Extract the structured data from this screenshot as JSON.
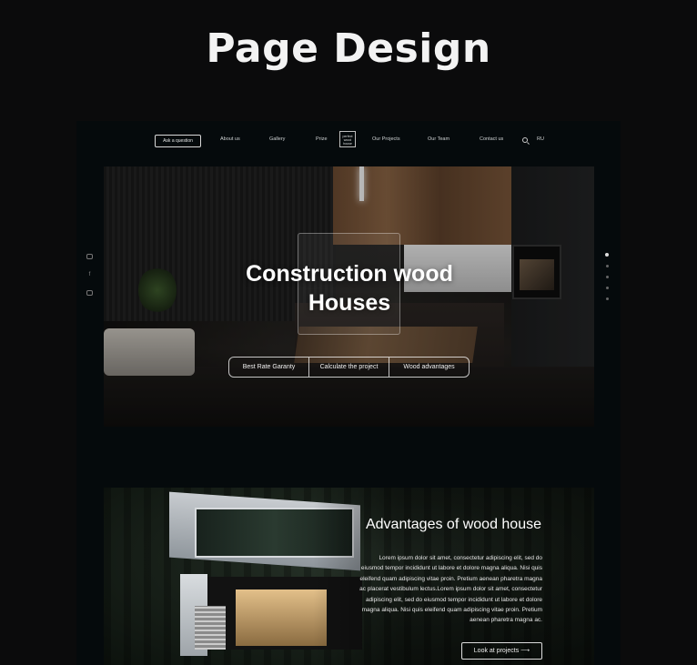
{
  "page": {
    "title": "Page Design"
  },
  "nav": {
    "ask_button": "Ask a question",
    "items": [
      "About us",
      "Gallery",
      "Prize",
      "Our Projects",
      "Our Team",
      "Contact us"
    ],
    "logo_text": [
      "perfect",
      "wood",
      "house"
    ],
    "language": "RU"
  },
  "hero": {
    "title_line1": "Construction wood",
    "title_line2": "Houses",
    "buttons": [
      "Best Rate Garanty",
      "Calculate the project",
      "Wood advantages"
    ],
    "slider_dots": 5,
    "active_dot": 0
  },
  "social": {
    "icons": [
      "instagram-icon",
      "facebook-icon",
      "youtube-icon"
    ]
  },
  "advantages": {
    "title": "Advantages of wood house",
    "text": "Lorem ipsum dolor sit amet, consectetur adipiscing elit, sed do eiusmod tempor incididunt ut labore et dolore magna aliqua. Nisi quis eleifend quam adipiscing vitae proin. Pretium aenean pharetra magna ac placerat vestibulum lectus.Lorem ipsum dolor sit amet, consectetur adipiscing elit, sed do eiusmod tempor incididunt ut labore et dolore magna aliqua. Nisi quis eleifend quam adipiscing vitae proin. Pretium aenean pharetra magna ac.",
    "button": "Look at projects",
    "button_arrow": "⟶"
  }
}
